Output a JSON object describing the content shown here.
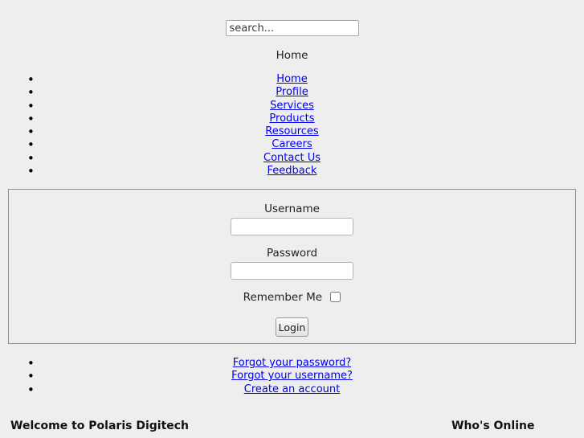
{
  "search": {
    "placeholder": "search...",
    "value": ""
  },
  "page": {
    "title": "Home"
  },
  "nav": {
    "items": [
      {
        "label": "Home"
      },
      {
        "label": "Profile"
      },
      {
        "label": "Services"
      },
      {
        "label": "Products"
      },
      {
        "label": "Resources"
      },
      {
        "label": "Careers"
      },
      {
        "label": "Contact Us"
      },
      {
        "label": "Feedback"
      }
    ]
  },
  "login": {
    "username_label": "Username",
    "username_value": "",
    "password_label": "Password",
    "password_value": "",
    "remember_label": "Remember Me",
    "remember_checked": false,
    "submit_label": "Login"
  },
  "help_links": {
    "items": [
      {
        "label": "Forgot your password?"
      },
      {
        "label": "Forgot your username?"
      },
      {
        "label": "Create an account"
      }
    ]
  },
  "modules": {
    "welcome_heading": "Welcome to Polaris Digitech",
    "online_heading": "Who's Online"
  },
  "colors": {
    "background": "#eeeeee",
    "link": "#0000ee",
    "text": "#1a1a1a",
    "border": "#8f8f8f"
  }
}
